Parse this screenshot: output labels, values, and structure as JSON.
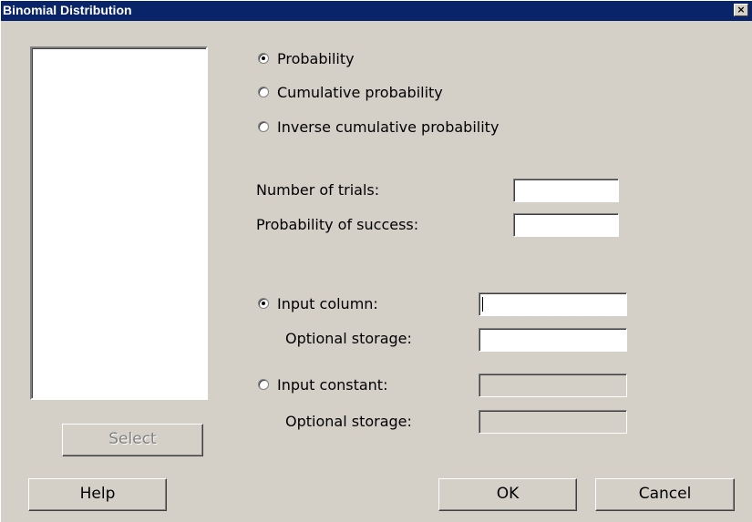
{
  "window": {
    "title": "Binomial Distribution",
    "close_glyph": "×"
  },
  "buttons": {
    "select": "Select",
    "help": "Help",
    "ok": "OK",
    "cancel": "Cancel"
  },
  "mode_options": [
    {
      "label": "Probability",
      "selected": true
    },
    {
      "label": "Cumulative probability",
      "selected": false
    },
    {
      "label": "Inverse cumulative probability",
      "selected": false
    }
  ],
  "params": {
    "number_of_trials": {
      "label": "Number of trials:",
      "value": ""
    },
    "probability_of_success": {
      "label": "Probability of success:",
      "value": ""
    }
  },
  "input": {
    "input_column": {
      "label": "Input column:",
      "selected": true,
      "value": ""
    },
    "optional_storage_1": {
      "label": "Optional storage:",
      "value": ""
    },
    "input_constant": {
      "label": "Input constant:",
      "selected": false,
      "value": ""
    },
    "optional_storage_2": {
      "label": "Optional storage:",
      "value": ""
    }
  }
}
